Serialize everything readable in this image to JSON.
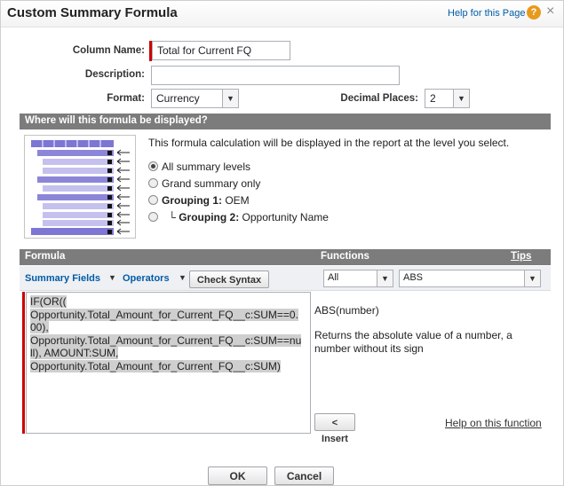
{
  "header": {
    "title": "Custom Summary Formula",
    "help_link": "Help for this Page",
    "help_icon": "question-circle-icon",
    "help_icon_glyph": "?",
    "close_icon": "close-icon",
    "close_glyph": "×"
  },
  "form": {
    "column_name_label": "Column Name:",
    "column_name_value": "Total for Current FQ",
    "description_label": "Description:",
    "description_value": "",
    "format_label": "Format:",
    "format_value": "Currency",
    "decimal_label": "Decimal Places:",
    "decimal_value": "2"
  },
  "display_section": {
    "header": "Where will this formula be displayed?",
    "intro": "This formula calculation will be displayed in the report at the level you select.",
    "options": [
      {
        "label": "All summary levels",
        "selected": true
      },
      {
        "label": "Grand summary only",
        "selected": false
      },
      {
        "bold": "Grouping 1:",
        "value": "OEM",
        "selected": false
      },
      {
        "prefix": "└",
        "bold": "Grouping 2:",
        "value": "Opportunity Name",
        "selected": false
      }
    ]
  },
  "formula_section": {
    "formula_header": "Formula",
    "functions_header": "Functions",
    "tips_link": "Tips",
    "summary_fields": "Summary Fields",
    "operators": "Operators",
    "check_syntax": "Check Syntax",
    "function_category": "All",
    "function_selected": "ABS",
    "formula_lines": [
      "IF(OR((",
      "Opportunity.Total_Amount_for_Current_FQ__c:SUM==0.",
      "00),",
      "Opportunity.Total_Amount_for_Current_FQ__c:SUM==nu",
      "ll), AMOUNT:SUM,",
      "Opportunity.Total_Amount_for_Current_FQ__c:SUM)"
    ],
    "function_signature": "ABS(number)",
    "function_description": "Returns the absolute value of a number, a number without its sign",
    "insert_button": "< Insert",
    "help_function_link": "Help on this function"
  },
  "footer": {
    "ok": "OK",
    "cancel": "Cancel"
  },
  "colors": {
    "section_bar": "#7c7c7c",
    "link": "#015ba7",
    "required": "#cc0000",
    "graphic_blue": "#8c86d8"
  }
}
